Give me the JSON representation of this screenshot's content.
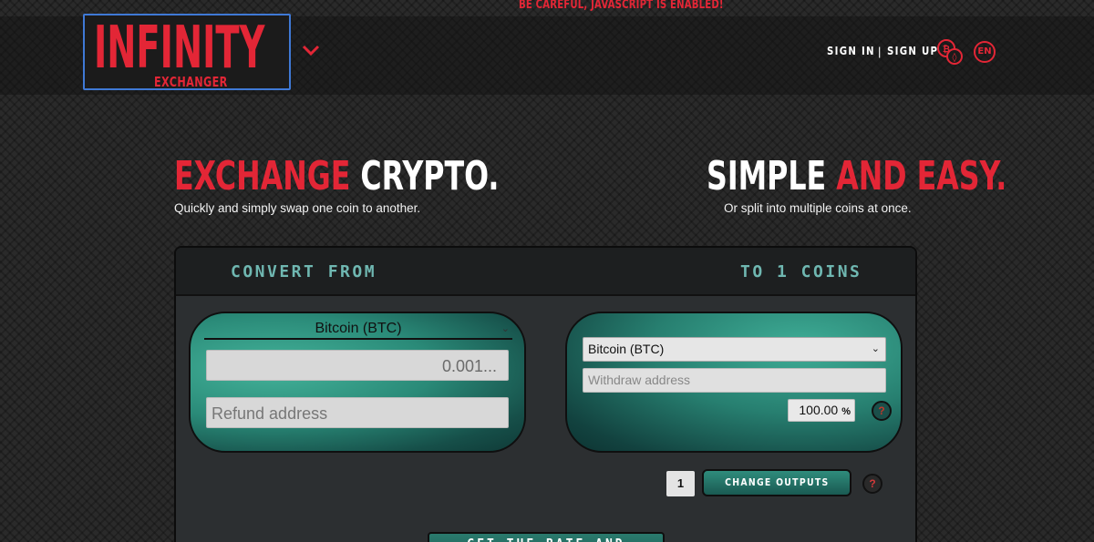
{
  "warning": "BE CAREFUL, JAVASCRIPT IS ENABLED!",
  "logo": {
    "main": "INFINITY",
    "sub": "EXCHANGER"
  },
  "nav": {
    "sign_in": "SIGN IN",
    "separator": "|",
    "sign_up": "SIGN UP",
    "language": "EN"
  },
  "hero": {
    "left_title_red": "EXCHANGE",
    "left_title_white": "CRYPTO.",
    "left_subtitle": "Quickly and simply swap one coin to another.",
    "right_title_white": "SIMPLE",
    "right_title_red": "AND EASY.",
    "right_subtitle": "Or split into multiple coins at once."
  },
  "panel": {
    "convert_from_label": "CONVERT FROM",
    "to_coins_label": "TO 1 COINS",
    "from": {
      "coin_select": "Bitcoin (BTC)",
      "amount_placeholder": "0.001...",
      "refund_placeholder": "Refund address"
    },
    "to": {
      "coin_select": "Bitcoin (BTC)",
      "withdraw_placeholder": "Withdraw address",
      "percent_value": "100.00",
      "percent_sign": "%",
      "help": "?"
    },
    "outputs_count": "1",
    "change_outputs_label": "CHANGE OUTPUTS",
    "help": "?",
    "rate_button": "GET THE RATE AND"
  },
  "colors": {
    "accent_red": "#e32636",
    "teal": "#2a8a78",
    "label_teal": "#6fb7b1",
    "logo_border": "#3f79d6"
  },
  "icons": {
    "menu": "chevron-down-icon",
    "coin": "coin-swap-icon"
  }
}
